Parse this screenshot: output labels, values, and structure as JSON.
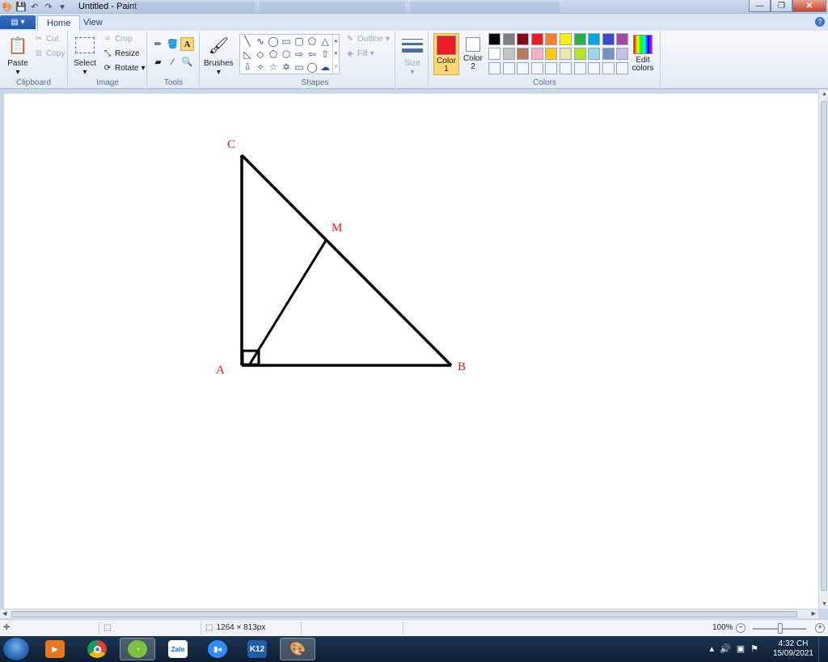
{
  "window": {
    "title": "Untitled - Paint"
  },
  "ribbon_tabs": [
    {
      "label": "Home",
      "active": true
    },
    {
      "label": "View",
      "active": false
    }
  ],
  "clipboard": {
    "paste": "Paste",
    "cut": "Cut",
    "copy": "Copy",
    "label": "Clipboard"
  },
  "image": {
    "select": "Select",
    "crop": "Crop",
    "resize": "Resize",
    "rotate": "Rotate",
    "label": "Image"
  },
  "tools": {
    "label": "Tools",
    "brushes": "Brushes"
  },
  "shapes": {
    "label": "Shapes",
    "outline": "Outline",
    "fill": "Fill"
  },
  "size": {
    "label": "Size"
  },
  "colors": {
    "label": "Colors",
    "color1_line1": "Color",
    "color1_line2": "1",
    "color2_line1": "Color",
    "color2_line2": "2",
    "edit_line1": "Edit",
    "edit_line2": "colors",
    "color1": "#ed1c24",
    "color2": "#ffffff",
    "palette_row1": [
      "#000000",
      "#7f7f7f",
      "#880015",
      "#ed1c24",
      "#ff7f27",
      "#fff200",
      "#22b14c",
      "#00a2e8",
      "#3f48cc",
      "#a349a4"
    ],
    "palette_row2": [
      "#ffffff",
      "#c3c3c3",
      "#b97a57",
      "#ffaec9",
      "#ffc90e",
      "#efe4b0",
      "#b5e61d",
      "#99d9ea",
      "#7092be",
      "#c8bfe7"
    ]
  },
  "drawing": {
    "label_color": "#d41c1c",
    "labels": {
      "a": "A",
      "b": "B",
      "c": "C",
      "m": "M"
    }
  },
  "status": {
    "canvas_size": "1264 × 813px",
    "zoom": "100%"
  },
  "taskbar": {
    "apps": [
      "media-player",
      "chrome",
      "greenshot",
      "zalo",
      "zoom",
      "k12",
      "paint"
    ],
    "zalo_text": "Zalo",
    "k12_text": "K12",
    "time": "4:32 CH",
    "date": "15/09/2021"
  }
}
